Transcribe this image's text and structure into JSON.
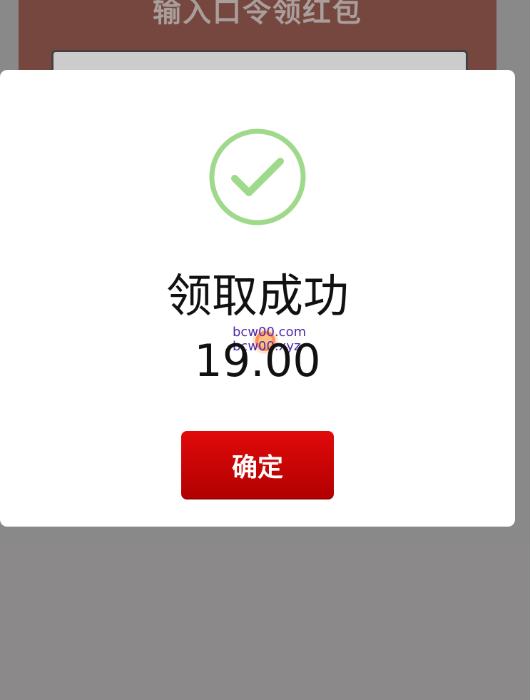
{
  "background": {
    "title": "输入口令领红包"
  },
  "modal": {
    "status_icon": "check-circle-icon",
    "title": "领取成功",
    "amount": "19.00",
    "confirm_label": "确定"
  },
  "watermark": {
    "line1": "bcw00.com",
    "line2": "bcw00.xyz"
  },
  "colors": {
    "success": "#9fd98b",
    "button": "#cf0202",
    "modal_bg": "#ffffff",
    "overlay": "#9a9898",
    "background_page": "#7a3426"
  }
}
